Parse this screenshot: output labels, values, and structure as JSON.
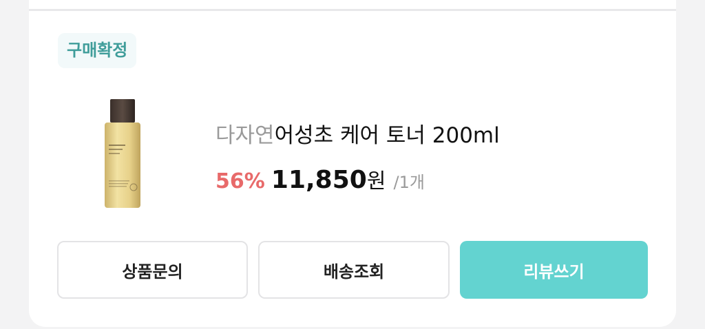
{
  "order": {
    "status": "구매확정",
    "product": {
      "brand": "다자연",
      "name": "어성초 케어 토너 200ml",
      "discount": "56%",
      "price": "11,850",
      "currency": "원",
      "quantity": "/1개",
      "image_icon": "toner-bottle-icon"
    },
    "actions": {
      "inquiry_label": "상품문의",
      "tracking_label": "배송조회",
      "review_label": "리뷰쓰기"
    }
  },
  "colors": {
    "accent": "#63d3d0",
    "status_text": "#3f9d9a",
    "discount": "#e86a6a"
  }
}
